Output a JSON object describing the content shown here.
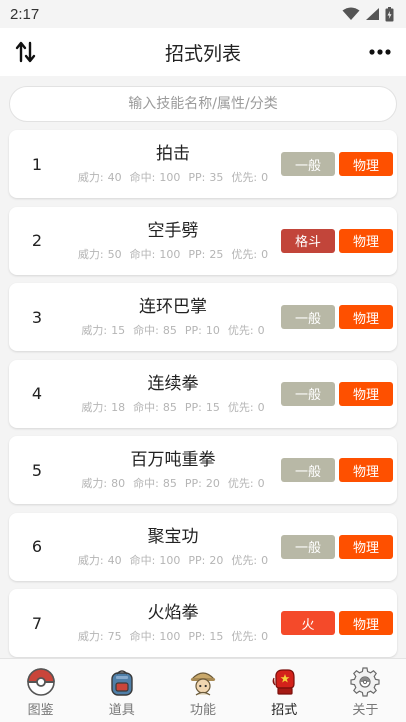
{
  "status": {
    "time": "2:17"
  },
  "header": {
    "title": "招式列表"
  },
  "search": {
    "placeholder": "输入技能名称/属性/分类"
  },
  "stat_labels": {
    "power": "威力:",
    "accuracy": "命中:",
    "pp": "PP:",
    "priority": "优先:"
  },
  "colors": {
    "normal": "#b8b8a6",
    "fighting": "#c2453a",
    "fire": "#f44a2a",
    "physical": "#fe5000"
  },
  "moves": [
    {
      "num": "1",
      "name": "拍击",
      "power": "40",
      "accuracy": "100",
      "pp": "35",
      "priority": "0",
      "type": "一般",
      "type_color": "#b8b8a6",
      "category": "物理"
    },
    {
      "num": "2",
      "name": "空手劈",
      "power": "50",
      "accuracy": "100",
      "pp": "25",
      "priority": "0",
      "type": "格斗",
      "type_color": "#c2453a",
      "category": "物理"
    },
    {
      "num": "3",
      "name": "连环巴掌",
      "power": "15",
      "accuracy": "85",
      "pp": "10",
      "priority": "0",
      "type": "一般",
      "type_color": "#b8b8a6",
      "category": "物理"
    },
    {
      "num": "4",
      "name": "连续拳",
      "power": "18",
      "accuracy": "85",
      "pp": "15",
      "priority": "0",
      "type": "一般",
      "type_color": "#b8b8a6",
      "category": "物理"
    },
    {
      "num": "5",
      "name": "百万吨重拳",
      "power": "80",
      "accuracy": "85",
      "pp": "20",
      "priority": "0",
      "type": "一般",
      "type_color": "#b8b8a6",
      "category": "物理"
    },
    {
      "num": "6",
      "name": "聚宝功",
      "power": "40",
      "accuracy": "100",
      "pp": "20",
      "priority": "0",
      "type": "一般",
      "type_color": "#b8b8a6",
      "category": "物理"
    },
    {
      "num": "7",
      "name": "火焰拳",
      "power": "75",
      "accuracy": "100",
      "pp": "15",
      "priority": "0",
      "type": "火",
      "type_color": "#f44a2a",
      "category": "物理"
    }
  ],
  "nav": [
    {
      "label": "图鉴",
      "icon": "pokeball-icon"
    },
    {
      "label": "道具",
      "icon": "backpack-icon"
    },
    {
      "label": "功能",
      "icon": "trainer-icon"
    },
    {
      "label": "招式",
      "icon": "boxing-glove-icon",
      "active": true
    },
    {
      "label": "关于",
      "icon": "gear-icon"
    }
  ]
}
